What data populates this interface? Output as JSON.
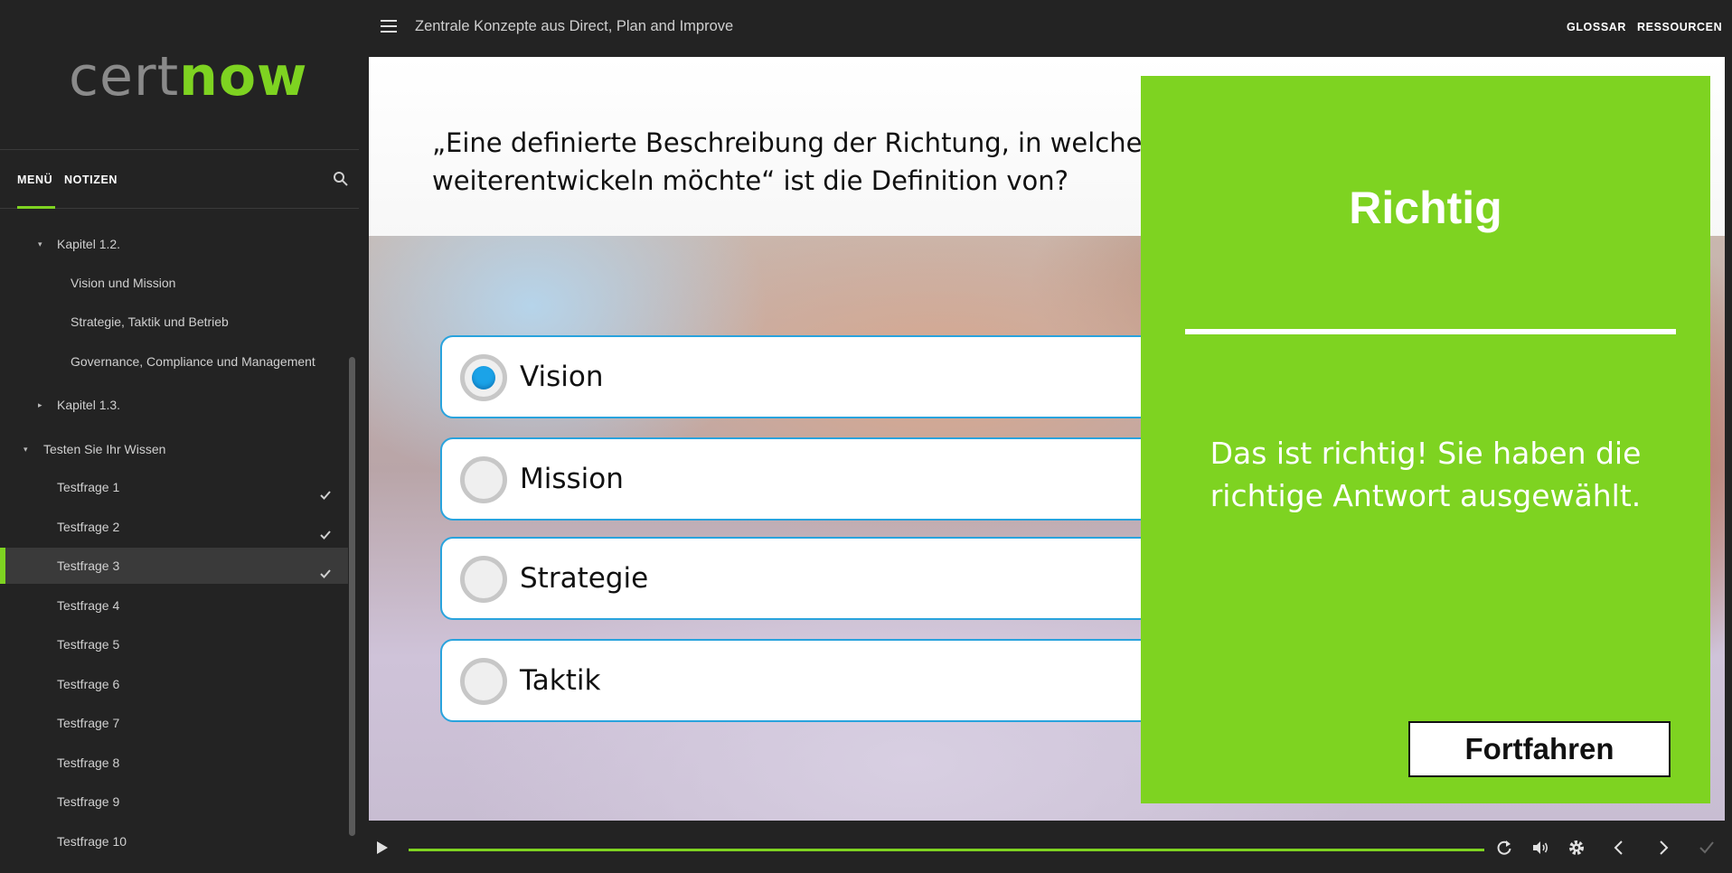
{
  "app": {
    "logo_cert": "cert",
    "logo_now": "now"
  },
  "sidebar": {
    "tabs": {
      "menu": "MENÜ",
      "notes": "NOTIZEN"
    },
    "items": [
      {
        "label": "Kapitel 1.2.",
        "caret": "▾"
      },
      {
        "label": "Vision und Mission"
      },
      {
        "label": "Strategie, Taktik und Betrieb"
      },
      {
        "label": "Governance, Compliance und Management"
      },
      {
        "label": "Kapitel 1.3.",
        "caret": "▸"
      },
      {
        "label": "Testen Sie Ihr Wissen",
        "caret": "▾"
      },
      {
        "label": "Testfrage 1",
        "completed": true
      },
      {
        "label": "Testfrage 2",
        "completed": true
      },
      {
        "label": "Testfrage 3",
        "completed": true,
        "active": true
      },
      {
        "label": "Testfrage 4"
      },
      {
        "label": "Testfrage 5"
      },
      {
        "label": "Testfrage 6"
      },
      {
        "label": "Testfrage 7"
      },
      {
        "label": "Testfrage 8"
      },
      {
        "label": "Testfrage 9"
      },
      {
        "label": "Testfrage 10"
      }
    ]
  },
  "header": {
    "course_title": "Zentrale Konzepte aus Direct, Plan and Improve",
    "glossar": "GLOSSAR",
    "ressourcen": "RESSOURCEN"
  },
  "slide": {
    "question": "„Eine definierte Beschreibung der Richtung, in welche s\nweiterentwickeln möchte“ ist die Definition von?",
    "answers": [
      {
        "label": "Vision",
        "selected": true
      },
      {
        "label": "Mission",
        "selected": false
      },
      {
        "label": "Strategie",
        "selected": false
      },
      {
        "label": "Taktik",
        "selected": false
      }
    ]
  },
  "feedback": {
    "title": "Richtig",
    "message": "Das ist richtig!  Sie haben die richtige Antwort ausgewählt.",
    "button": "Fortfahren"
  },
  "player": {
    "progress": 1.0,
    "colors": {
      "accent": "#7ed321",
      "selection": "#29a3dd"
    }
  }
}
